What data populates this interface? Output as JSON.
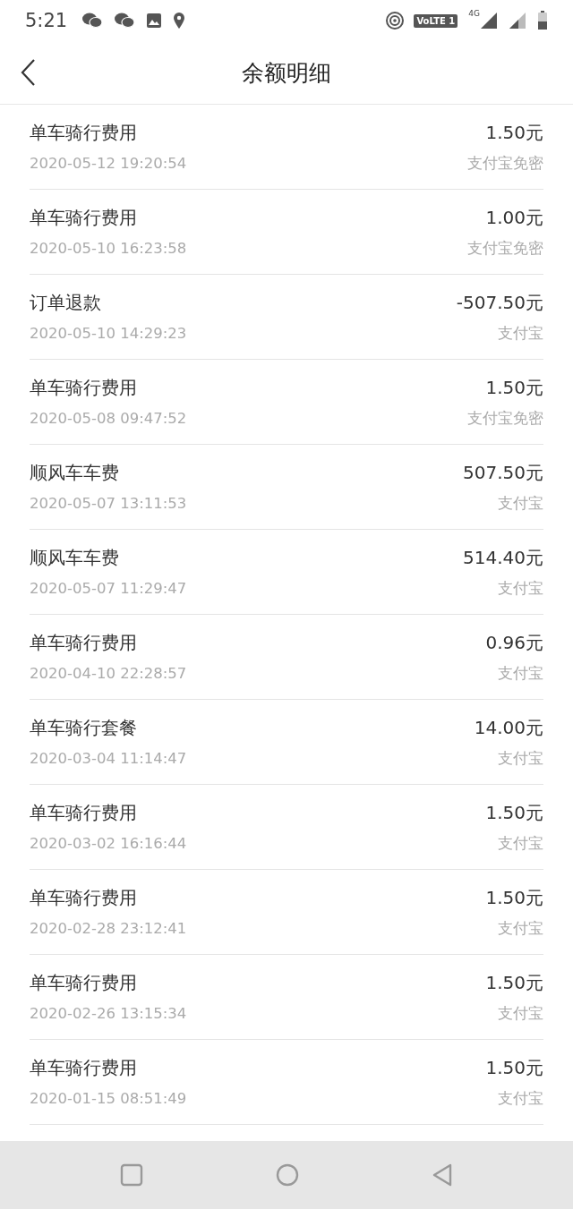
{
  "status_bar": {
    "time": "5:21",
    "volte": "VoLTE 1",
    "network": "4G"
  },
  "header": {
    "title": "余额明细"
  },
  "records": [
    {
      "title": "单车骑行费用",
      "amount": "1.50元",
      "date": "2020-05-12 19:20:54",
      "method": "支付宝免密"
    },
    {
      "title": "单车骑行费用",
      "amount": "1.00元",
      "date": "2020-05-10 16:23:58",
      "method": "支付宝免密"
    },
    {
      "title": "订单退款",
      "amount": "-507.50元",
      "date": "2020-05-10 14:29:23",
      "method": "支付宝"
    },
    {
      "title": "单车骑行费用",
      "amount": "1.50元",
      "date": "2020-05-08 09:47:52",
      "method": "支付宝免密"
    },
    {
      "title": "顺风车车费",
      "amount": "507.50元",
      "date": "2020-05-07 13:11:53",
      "method": "支付宝"
    },
    {
      "title": "顺风车车费",
      "amount": "514.40元",
      "date": "2020-05-07 11:29:47",
      "method": "支付宝"
    },
    {
      "title": "单车骑行费用",
      "amount": "0.96元",
      "date": "2020-04-10 22:28:57",
      "method": "支付宝"
    },
    {
      "title": "单车骑行套餐",
      "amount": "14.00元",
      "date": "2020-03-04 11:14:47",
      "method": "支付宝"
    },
    {
      "title": "单车骑行费用",
      "amount": "1.50元",
      "date": "2020-03-02 16:16:44",
      "method": "支付宝"
    },
    {
      "title": "单车骑行费用",
      "amount": "1.50元",
      "date": "2020-02-28 23:12:41",
      "method": "支付宝"
    },
    {
      "title": "单车骑行费用",
      "amount": "1.50元",
      "date": "2020-02-26 13:15:34",
      "method": "支付宝"
    },
    {
      "title": "单车骑行费用",
      "amount": "1.50元",
      "date": "2020-01-15 08:51:49",
      "method": "支付宝"
    }
  ]
}
